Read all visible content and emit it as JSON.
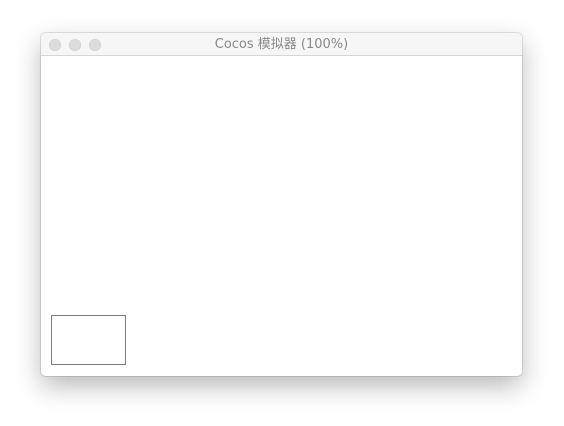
{
  "window": {
    "title": "Cocos 模拟器 (100%)",
    "controls": {
      "close_icon": "close-icon",
      "minimize_icon": "minimize-icon",
      "zoom_icon": "zoom-icon",
      "inactive_color": "#dcdcdc"
    }
  },
  "colors": {
    "titlebar_background": "#f6f6f6",
    "title_text": "#8a8a8a",
    "canvas_background": "#ffffff",
    "rect_outline": "#808080"
  }
}
